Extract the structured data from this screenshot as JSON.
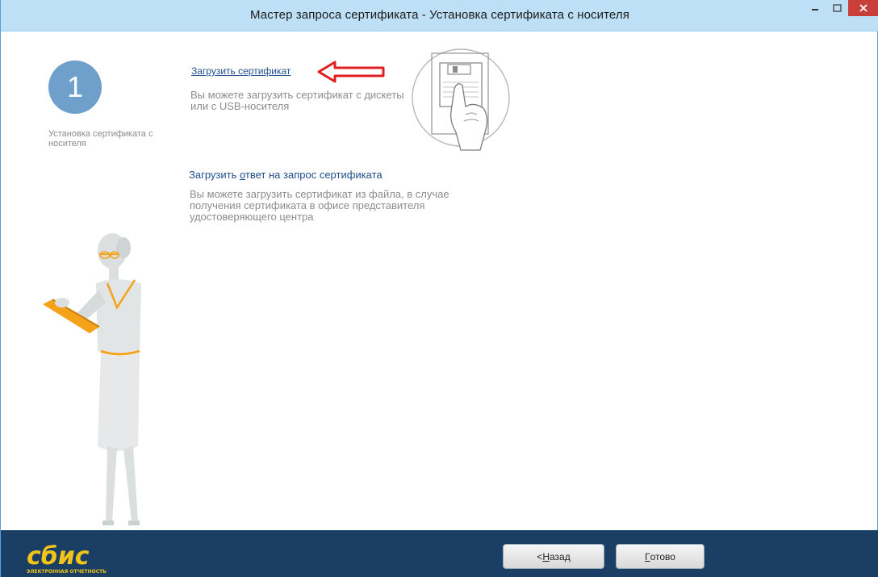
{
  "window": {
    "title": "Мастер запроса сертификата - Установка сертификата с носителя",
    "minimize_icon": "minimize-icon",
    "maximize_icon": "maximize-icon",
    "close_icon": "close-icon"
  },
  "sidebar": {
    "step_number": "1",
    "step_label": "Установка сертификата с носителя",
    "illustration": "woman-illustration"
  },
  "options": [
    {
      "link": "Загрузить сертификат",
      "description": "Вы можете загрузить сертификат с дискеты или с USB-носителя",
      "illustration": "floppy-disk-hand-illustration",
      "annotation": "red-arrow-icon"
    },
    {
      "link_prefix": "Загрузить ",
      "link_accel": "о",
      "link_suffix": "твет на запрос сертификата",
      "description": "Вы можете загрузить сертификат из файла, в случае получения сертификата в офисе представителя удостоверяющего центра"
    }
  ],
  "footer": {
    "logo_text": "сбис",
    "logo_subtext": "ЭЛЕКТРОННАЯ ОТЧЕТНОСТЬ",
    "back_prefix": "< ",
    "back_accel": "Н",
    "back_suffix": "азад",
    "done_accel": "Г",
    "done_suffix": "отово"
  },
  "colors": {
    "titlebar": "#bde0f6",
    "footer": "#1a3e64",
    "step_circle": "#6fa0cc",
    "link": "#1f4e8c",
    "accent_orange": "#f4a21a",
    "logo_yellow": "#f0c419",
    "arrow_red": "#e02020",
    "close_red": "#c9403a"
  }
}
